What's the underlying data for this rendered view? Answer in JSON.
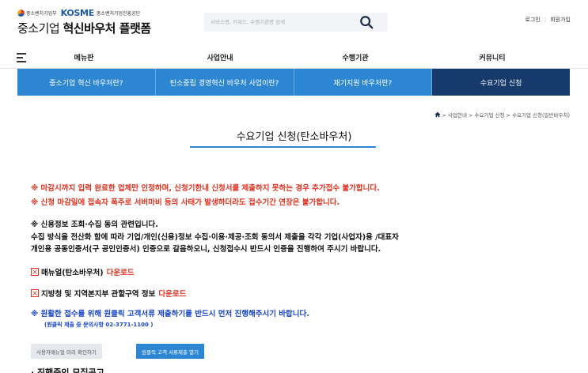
{
  "header": {
    "ministry": "중소벤처기업부",
    "kosme_brand": "KOSME",
    "kosme_sub": "중소벤처기업진흥공단",
    "title_prefix": "중소기업",
    "title_main": "혁신바우처 플랫폼",
    "search_placeholder": "서비스명, 키워드, 수행기관명 검색",
    "login": "로그인",
    "signup": "회원가입"
  },
  "gnb": {
    "items": [
      "메뉴판",
      "사업안내",
      "수행기관",
      "커뮤니티"
    ]
  },
  "subnav": {
    "tabs": [
      "중소기업 혁신 바우처란?",
      "탄소중립 경영혁신 바우처 사업이란?",
      "재기지원 바우처란?",
      "수요기업 신청"
    ],
    "active_index": 3
  },
  "breadcrumb": "> 사업안내 > 수요기업 신청 > 수요기업 신청(일반바우처)",
  "page_title": "수요기업 신청(탄소바우처)",
  "notices": {
    "red1": "※ 마감시까지 입력 완료한 업체만 인정하며, 신청기한내 신청서를 제출하지 못하는 경우 추가접수 불가합니다.",
    "red2": "※ 신청 마감일에 접속자 폭주로 서버마비 등의 사태가 발생하더라도 접수기간 연장은 불가합니다.",
    "credit_title": "※ 신용정보 조회·수집 동의 관련입니다.",
    "credit_line1": "수집 방식을 전산화 함에 따라 기업/개인(신용)정보 수집·이용·제공·조회 동의서 제출을 각각 기업(사업자)용 /대표자",
    "credit_line2": "개인용 공동인증서(구 공인인증서) 인증으로 갈음하오니, 신청접수시 반드시 인증을 진행하여 주시기 바랍니다.",
    "manual_label": "매뉴얼(탄소바우처)",
    "manual_link": "다운로드",
    "region_label": "지방청 및 지역본지부 관할구역 정보",
    "region_link": "다운로드",
    "blue_notice": "※ 원활한 접수를 위해 원클릭 고객서류 제출하기를 반드시 먼저 진행해주시기 바랍니다.",
    "blue_sub": "(원클릭 제출 중 문의사항 02-3771-1100 )"
  },
  "buttons": {
    "manual_preview": "사용자매뉴얼 미리 확인하기",
    "oneclick": "원클릭 고객 서류제출 열기"
  },
  "section_title": "· 진행중인 모집공고",
  "colors": {
    "primary": "#2c86d2",
    "active_tab": "#163a6c",
    "alert_red": "#e0321f",
    "notice_blue": "#1846c8"
  }
}
